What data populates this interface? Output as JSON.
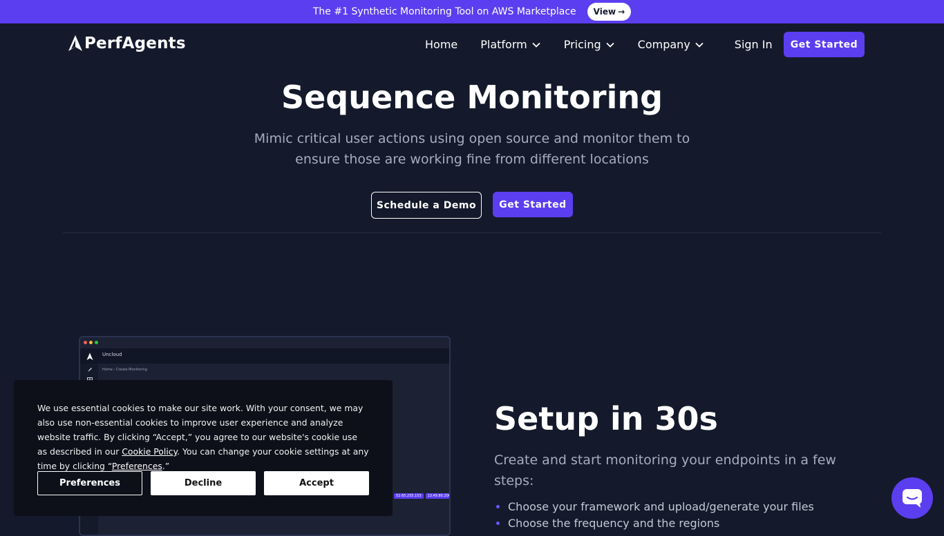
{
  "announcement": {
    "text": "The #1 Synthetic Monitoring Tool on AWS Marketplace",
    "button_label": "View",
    "button_arrow": "→"
  },
  "brand": {
    "name": "PerfAgents"
  },
  "nav": {
    "items": [
      {
        "label": "Home",
        "has_dropdown": false
      },
      {
        "label": "Platform",
        "has_dropdown": true
      },
      {
        "label": "Pricing",
        "has_dropdown": true
      },
      {
        "label": "Company",
        "has_dropdown": true
      },
      {
        "label": "Sign In",
        "has_dropdown": false
      }
    ],
    "cta_label": "Get Started"
  },
  "hero": {
    "title": "Sequence Monitoring",
    "subtitle": "Mimic critical user actions using open source and monitor them to ensure those are working fine from different locations",
    "secondary_button": "Schedule a Demo",
    "primary_button": "Get Started"
  },
  "screenshot_mock": {
    "org_name": "Uncloud",
    "breadcrumb": "Home  ›  Create Monitoring",
    "tags": [
      "52.65.255.153",
      "13.49.80.206"
    ]
  },
  "feature": {
    "title": "Setup in 30s",
    "subtitle": "Create and start monitoring your endpoints in a few steps:",
    "bullets": [
      "Choose your framework and upload/generate your files",
      "Choose the frequency and the regions"
    ]
  },
  "cookie_banner": {
    "text_before_link": "We use essential cookies to make our site work. With your consent, we may also use non-essential cookies to improve user experience and analyze website traffic. By clicking “Accept,” you agree to our website's cookie use as described in our ",
    "policy_link": "Cookie Policy",
    "text_middle": ". You can change your cookie settings at any time by clicking “",
    "preferences_link": "Preferences",
    "text_end": ".”",
    "buttons": {
      "preferences": "Preferences",
      "decline": "Decline",
      "accept": "Accept"
    }
  },
  "colors": {
    "background": "#141a2b",
    "accent": "#5b3ef0",
    "muted_text": "#a6adbd",
    "cookie_bg": "#0d1019"
  },
  "icons": {
    "logo": "perfagents-logo-icon",
    "dropdown": "chevron-down-icon",
    "chat": "chat-bubble-icon"
  }
}
